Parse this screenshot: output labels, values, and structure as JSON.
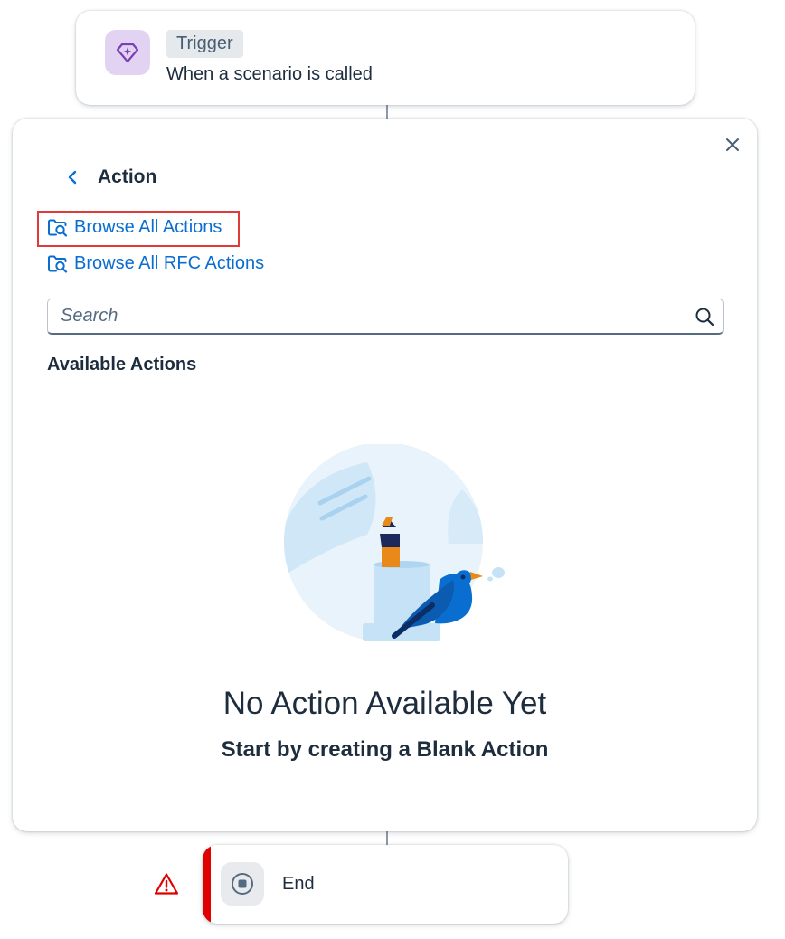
{
  "trigger": {
    "badge": "Trigger",
    "description": "When a scenario is called",
    "icon": "diamond-sparkle-icon",
    "icon_bg": "#e2d3f3",
    "icon_color": "#7b3fb8"
  },
  "action_panel": {
    "title": "Action",
    "links": [
      {
        "label": "Browse All Actions",
        "icon": "folder-search-icon",
        "highlighted": true
      },
      {
        "label": "Browse All RFC Actions",
        "icon": "folder-search-icon",
        "highlighted": false
      }
    ],
    "search": {
      "placeholder": "Search",
      "value": ""
    },
    "section_heading": "Available Actions",
    "empty_state": {
      "title": "No Action Available Yet",
      "subtitle": "Start by creating a Blank Action"
    }
  },
  "end_node": {
    "label": "End",
    "icon": "stop-icon",
    "status": "error",
    "status_icon": "warning-icon"
  },
  "colors": {
    "link": "#0a6ed1",
    "text": "#1d2d3e",
    "error": "#e00000",
    "highlight_border": "#e03a3a"
  }
}
